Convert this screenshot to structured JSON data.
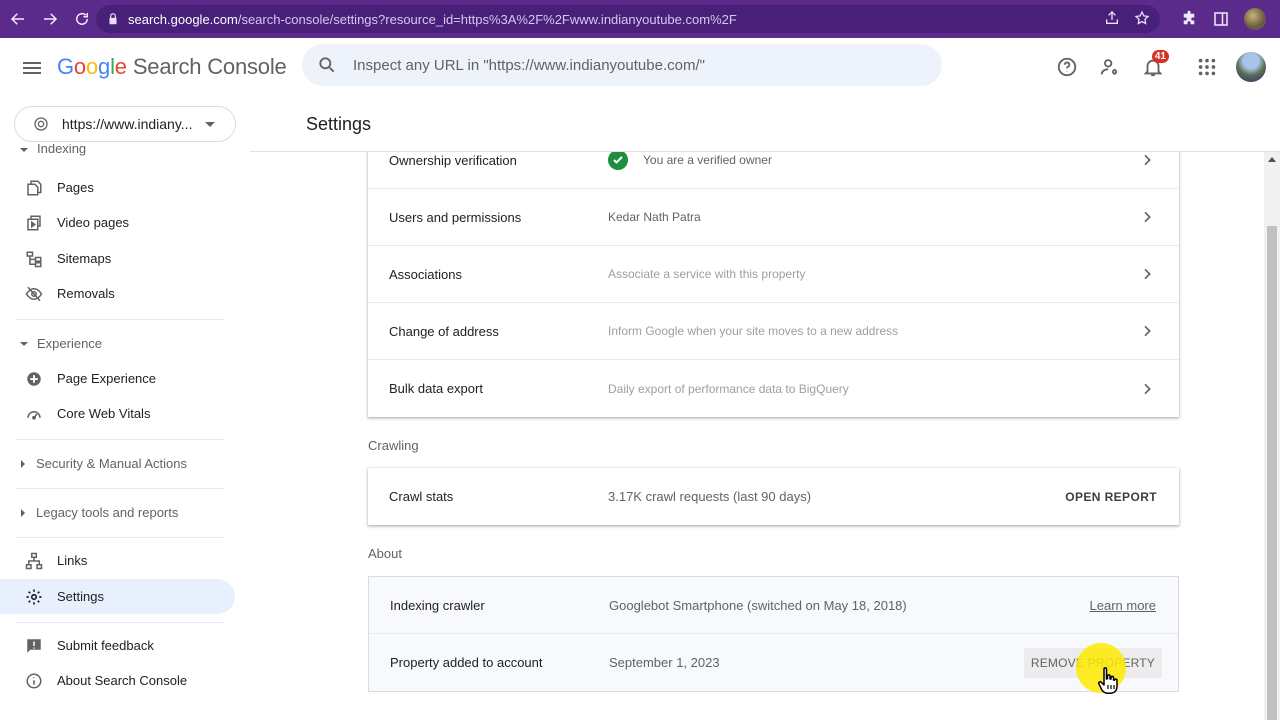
{
  "browser": {
    "url_host": "search.google.com",
    "url_path": "/search-console/settings?resource_id=https%3A%2F%2Fwww.indianyoutube.com%2F"
  },
  "header": {
    "logo_google": [
      "G",
      "o",
      "o",
      "g",
      "l",
      "e"
    ],
    "product_name": "Search Console",
    "search_placeholder": "Inspect any URL in \"https://www.indianyoutube.com/\"",
    "notifications_count": "41"
  },
  "sidebar": {
    "property": "https://www.indiany...",
    "indexing_label": "Indexing",
    "indexing_items": [
      {
        "label": "Pages",
        "icon": "pages-icon"
      },
      {
        "label": "Video pages",
        "icon": "video-pages-icon"
      },
      {
        "label": "Sitemaps",
        "icon": "sitemaps-icon"
      },
      {
        "label": "Removals",
        "icon": "removals-icon"
      }
    ],
    "experience_label": "Experience",
    "experience_items": [
      {
        "label": "Page Experience",
        "icon": "page-experience-icon"
      },
      {
        "label": "Core Web Vitals",
        "icon": "core-web-vitals-icon"
      }
    ],
    "security_label": "Security & Manual Actions",
    "legacy_label": "Legacy tools and reports",
    "links_label": "Links",
    "settings_label": "Settings",
    "feedback_label": "Submit feedback",
    "about_label": "About Search Console"
  },
  "page": {
    "title": "Settings"
  },
  "general_rows": [
    {
      "name": "Ownership verification",
      "value": "You are a verified owner"
    },
    {
      "name": "Users and permissions",
      "value": "Kedar Nath Patra"
    },
    {
      "name": "Associations",
      "value": "Associate a service with this property"
    },
    {
      "name": "Change of address",
      "value": "Inform Google when your site moves to a new address"
    },
    {
      "name": "Bulk data export",
      "value": "Daily export of performance data to BigQuery"
    }
  ],
  "crawling": {
    "label": "Crawling",
    "row_name": "Crawl stats",
    "row_value": "3.17K crawl requests (last 90 days)",
    "action": "OPEN REPORT"
  },
  "about": {
    "label": "About",
    "crawler_name": "Indexing crawler",
    "crawler_value": "Googlebot Smartphone (switched on May 18, 2018)",
    "learn_more": "Learn more",
    "added_name": "Property added to account",
    "added_value": "September 1, 2023",
    "remove_label": "REMOVE PROPERTY"
  },
  "colors": {
    "chrome": "#5b2b8c",
    "active_nav": "#e8f0fe",
    "verified": "#1e8e3e",
    "highlight": "#ffeb00"
  }
}
